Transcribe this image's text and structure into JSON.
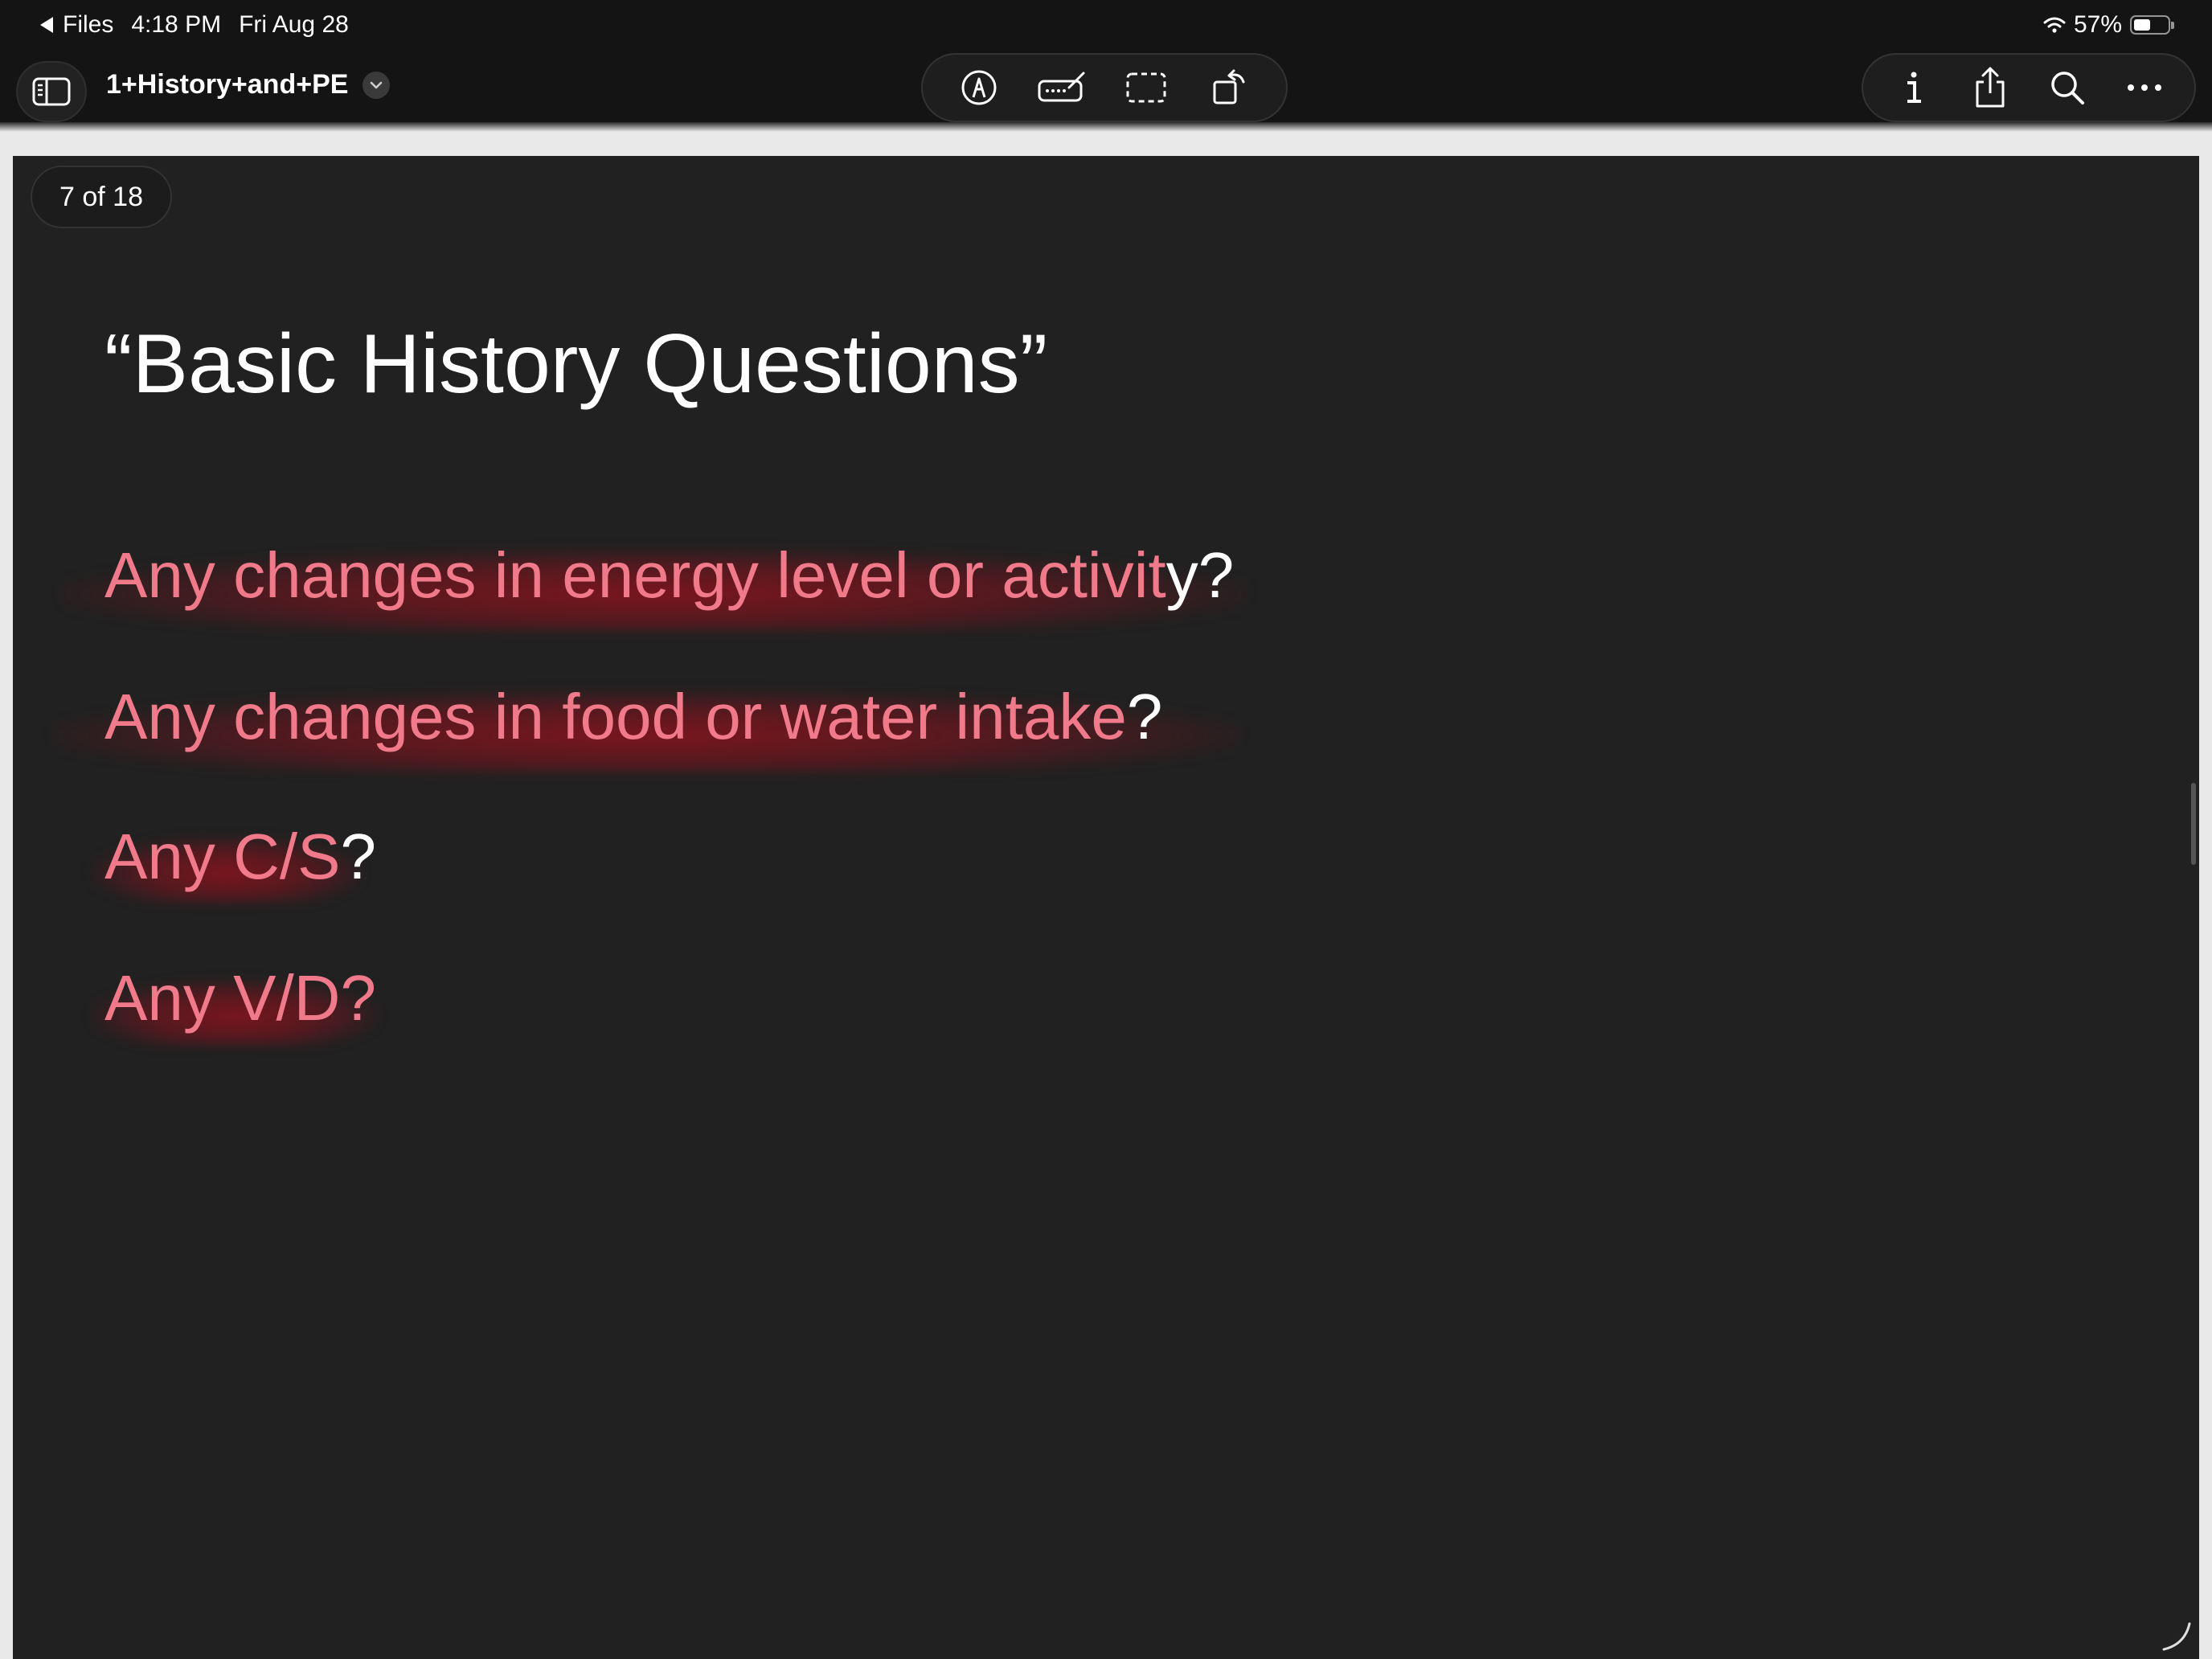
{
  "status_bar": {
    "back_label": "Files",
    "time": "4:18 PM",
    "date": "Fri Aug 28",
    "battery": "57%",
    "battery_level": 0.57
  },
  "toolbar": {
    "document_title": "1+History+and+PE",
    "center_icons": [
      "markup-pen-icon",
      "text-box-signature-icon",
      "selection-box-icon",
      "rotate-page-icon"
    ],
    "right_icons": [
      "info-icon",
      "share-icon",
      "search-icon",
      "more-icon"
    ]
  },
  "page": {
    "counter": "7 of 18",
    "title": "“Basic History Questions”",
    "bullets": [
      {
        "highlighted": "Any changes in energy level or activit",
        "rest": "y?"
      },
      {
        "highlighted": "Any changes in food or water intake",
        "rest": "?"
      },
      {
        "highlighted": "Any C/S",
        "rest": "?"
      },
      {
        "highlighted": "Any V/D?",
        "rest": ""
      }
    ]
  },
  "colors": {
    "chrome_bg": "#141414",
    "page_bg": "#212121",
    "highlight_ink": "#8c141e",
    "highlighted_text": "#f07a8a"
  }
}
